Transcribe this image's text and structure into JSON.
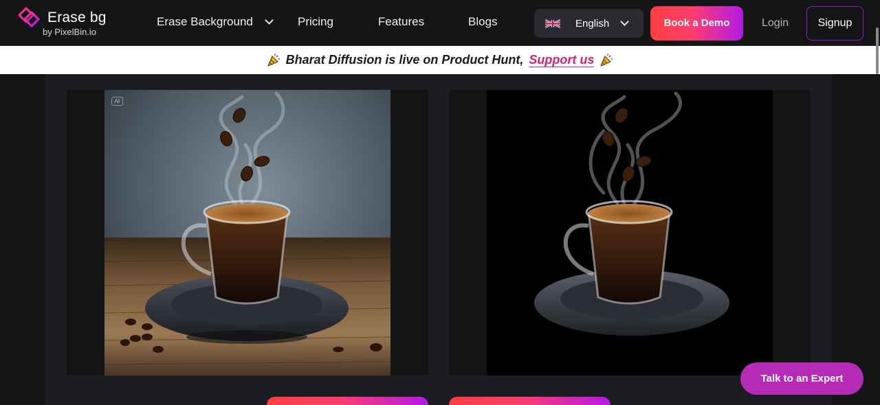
{
  "brand": {
    "title": "Erase bg",
    "subtitle": "by PixelBin.io",
    "accent_pink": "#ff3d6e",
    "accent_purple": "#b21ae6",
    "logo_icon": "erasebg-logo-icon"
  },
  "nav": {
    "items": [
      {
        "label": "Erase Background",
        "has_dropdown": true
      },
      {
        "label": "Pricing"
      },
      {
        "label": "Features"
      },
      {
        "label": "Blogs"
      }
    ],
    "language": {
      "label": "English",
      "flag": "uk-flag-icon"
    },
    "demo_label": "Book a Demo",
    "login_label": "Login",
    "signup_label": "Signup"
  },
  "banner": {
    "text": "Bharat Diffusion is live on Product Hunt,",
    "link_label": "Support us",
    "icon": "party-popper-icon"
  },
  "preview": {
    "original": {
      "badge": "AI",
      "alt": "coffee-cup-with-background"
    },
    "result": {
      "alt": "coffee-cup-background-removed"
    }
  },
  "floating": {
    "talk_label": "Talk to an Expert",
    "color": "#b62bb5"
  }
}
